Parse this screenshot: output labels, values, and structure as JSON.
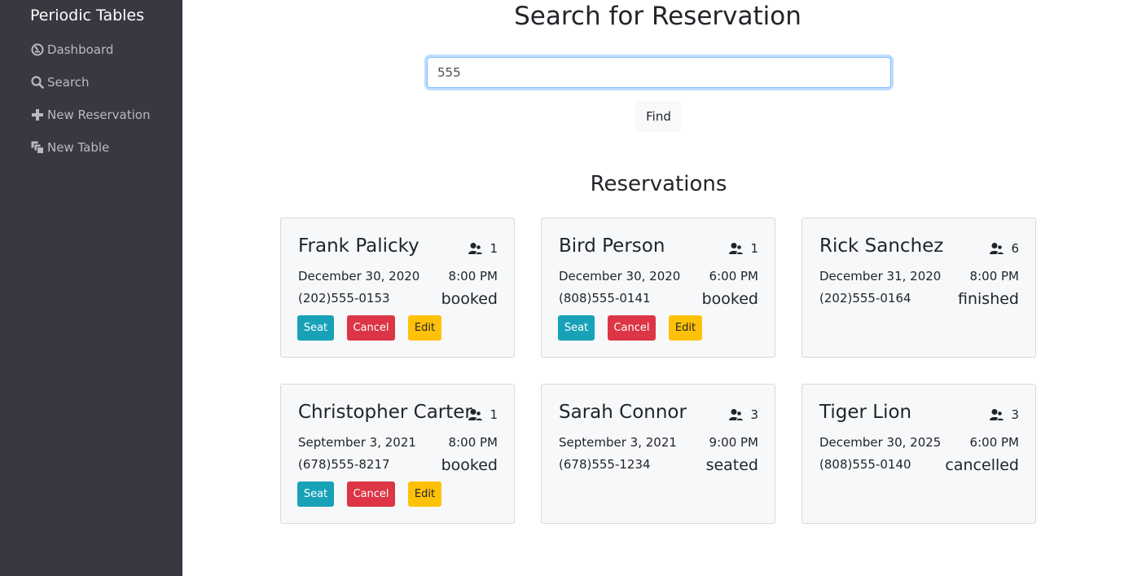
{
  "sidebar": {
    "brand": "Periodic Tables",
    "items": [
      {
        "label": "Dashboard",
        "icon": "dashboard-icon"
      },
      {
        "label": "Search",
        "icon": "search-icon"
      },
      {
        "label": "New Reservation",
        "icon": "plus-icon"
      },
      {
        "label": "New Table",
        "icon": "layers-icon"
      }
    ]
  },
  "search": {
    "title": "Search for Reservation",
    "value": "555",
    "button_label": "Find"
  },
  "reservations": {
    "title": "Reservations",
    "seat_label": "Seat",
    "cancel_label": "Cancel",
    "edit_label": "Edit",
    "cards": [
      {
        "name": "Frank Palicky",
        "people": "1",
        "date": "December 30, 2020",
        "time": "8:00 PM",
        "phone": "(202)555-0153",
        "status": "booked"
      },
      {
        "name": "Bird Person",
        "people": "1",
        "date": "December 30, 2020",
        "time": "6:00 PM",
        "phone": "(808)555-0141",
        "status": "booked"
      },
      {
        "name": "Rick Sanchez",
        "people": "6",
        "date": "December 31, 2020",
        "time": "8:00 PM",
        "phone": "(202)555-0164",
        "status": "finished"
      },
      {
        "name": "Christopher Carter",
        "people": "1",
        "date": "September 3, 2021",
        "time": "8:00 PM",
        "phone": "(678)555-8217",
        "status": "booked"
      },
      {
        "name": "Sarah Connor",
        "people": "3",
        "date": "September 3, 2021",
        "time": "9:00 PM",
        "phone": "(678)555-1234",
        "status": "seated"
      },
      {
        "name": "Tiger Lion",
        "people": "3",
        "date": "December 30, 2025",
        "time": "6:00 PM",
        "phone": "(808)555-0140",
        "status": "cancelled"
      }
    ]
  },
  "colors": {
    "sidebar_bg": "#383842",
    "seat": "#17a2b8",
    "cancel": "#dc3545",
    "edit": "#ffc107"
  }
}
